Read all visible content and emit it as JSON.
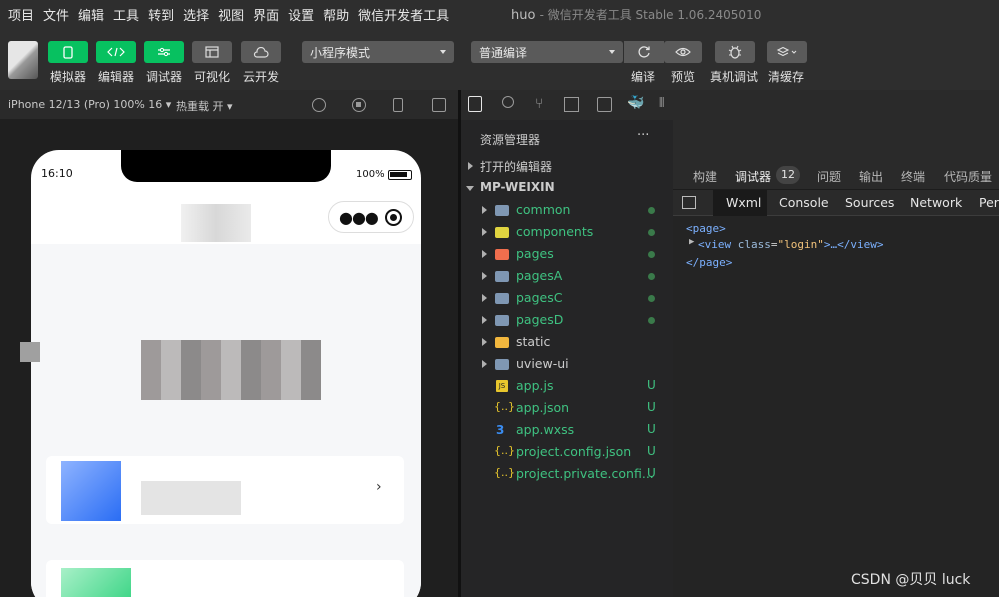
{
  "menu": [
    "项目",
    "文件",
    "编辑",
    "工具",
    "转到",
    "选择",
    "视图",
    "界面",
    "设置",
    "帮助",
    "微信开发者工具"
  ],
  "window": {
    "title": "huo",
    "subtitle": "- 微信开发者工具 Stable 1.06.2405010"
  },
  "toolbar": {
    "simulator": "模拟器",
    "editor": "编辑器",
    "debugger": "调试器",
    "visual": "可视化",
    "cloud": "云开发",
    "mode_select": "小程序模式",
    "compile_select": "普通编译",
    "compile": "编译",
    "preview": "预览",
    "remote_debug": "真机调试",
    "clear_cache": "清缓存"
  },
  "simulator": {
    "device": "iPhone 12/13 (Pro) 100% 16",
    "hot_reload": "热重载 开",
    "time": "16:10",
    "battery": "100%"
  },
  "explorer": {
    "title": "资源管理器",
    "more": "···",
    "open_editors": "打开的编辑器",
    "root": "MP-WEIXIN",
    "items": [
      {
        "name": "common",
        "type": "folder",
        "status": "dot"
      },
      {
        "name": "components",
        "type": "folder-components",
        "status": "dot"
      },
      {
        "name": "pages",
        "type": "folder-pages",
        "status": "dot"
      },
      {
        "name": "pagesA",
        "type": "folder",
        "status": "dot"
      },
      {
        "name": "pagesC",
        "type": "folder",
        "status": "dot"
      },
      {
        "name": "pagesD",
        "type": "folder",
        "status": "dot"
      },
      {
        "name": "static",
        "type": "folder-static",
        "status": ""
      },
      {
        "name": "uview-ui",
        "type": "folder",
        "status": ""
      },
      {
        "name": "app.js",
        "type": "js",
        "status": "U"
      },
      {
        "name": "app.json",
        "type": "json",
        "status": "U"
      },
      {
        "name": "app.wxss",
        "type": "css",
        "status": "U"
      },
      {
        "name": "project.config.json",
        "type": "json",
        "status": "U"
      },
      {
        "name": "project.private.confi...",
        "type": "json",
        "status": "U"
      }
    ]
  },
  "debug_tabs": {
    "build": "构建",
    "debugger": "调试器",
    "count": "12",
    "issues": "问题",
    "output": "输出",
    "terminal": "终端",
    "quality": "代码质量"
  },
  "devtools_tabs": {
    "wxml": "Wxml",
    "console": "Console",
    "sources": "Sources",
    "network": "Network",
    "perf": "Perf"
  },
  "wxml": {
    "open": "<page>",
    "view_tag": "<view ",
    "view_attr": "class",
    "view_val": "\"login\"",
    "view_tail": ">…</view>",
    "close": "</page>"
  },
  "watermark": "CSDN @贝贝 luck"
}
